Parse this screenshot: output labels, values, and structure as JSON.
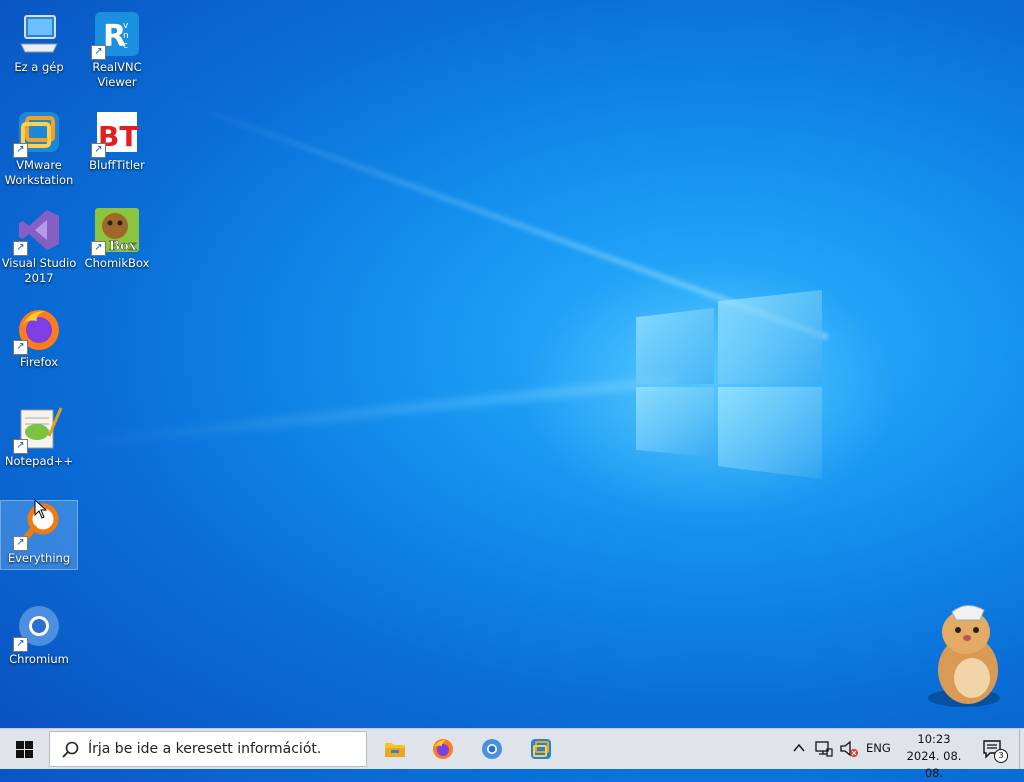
{
  "desktop": {
    "icons": [
      {
        "label": "Ez a gép"
      },
      {
        "label": "RealVNC Viewer"
      },
      {
        "label": "VMware Workstation"
      },
      {
        "label": "BluffTitler"
      },
      {
        "label": "Visual Studio 2017"
      },
      {
        "label": "ChomikBox"
      },
      {
        "label": "Firefox"
      },
      {
        "label": "Notepad++"
      },
      {
        "label": "Everything"
      },
      {
        "label": "Chromium"
      }
    ],
    "chomik_badge": "Box",
    "bluff_badge": "BT",
    "vnc_letters": "R"
  },
  "taskbar": {
    "search_placeholder": "Írja be ide a keresett információt.",
    "language": "ENG",
    "time": "10:23",
    "date": "2024. 08. 08.",
    "notification_count": "3"
  },
  "colors": {
    "taskbar_bg": "#dfe3ea",
    "desktop_blue": "#1593f0"
  }
}
